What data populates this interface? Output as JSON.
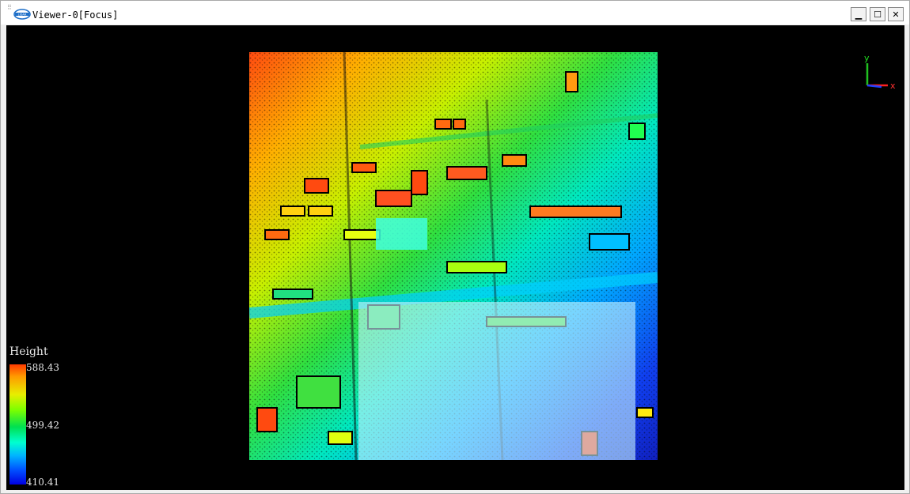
{
  "window": {
    "title": "Viewer-0[Focus]",
    "logo_icon": "lidar-logo-icon",
    "controls": {
      "minimize": "▁",
      "maximize": "☐",
      "close": "✕"
    }
  },
  "axes": {
    "y_label": "y",
    "x_label": "x",
    "colors": {
      "x": "#ff2020",
      "y": "#20c020",
      "z": "#2040ff"
    }
  },
  "legend": {
    "title": "Height",
    "max": "588.43",
    "mid": "499.42",
    "min": "410.41"
  },
  "colors": {
    "viewport_bg": "#000000",
    "selection_overlay": "#c8f4ff"
  }
}
